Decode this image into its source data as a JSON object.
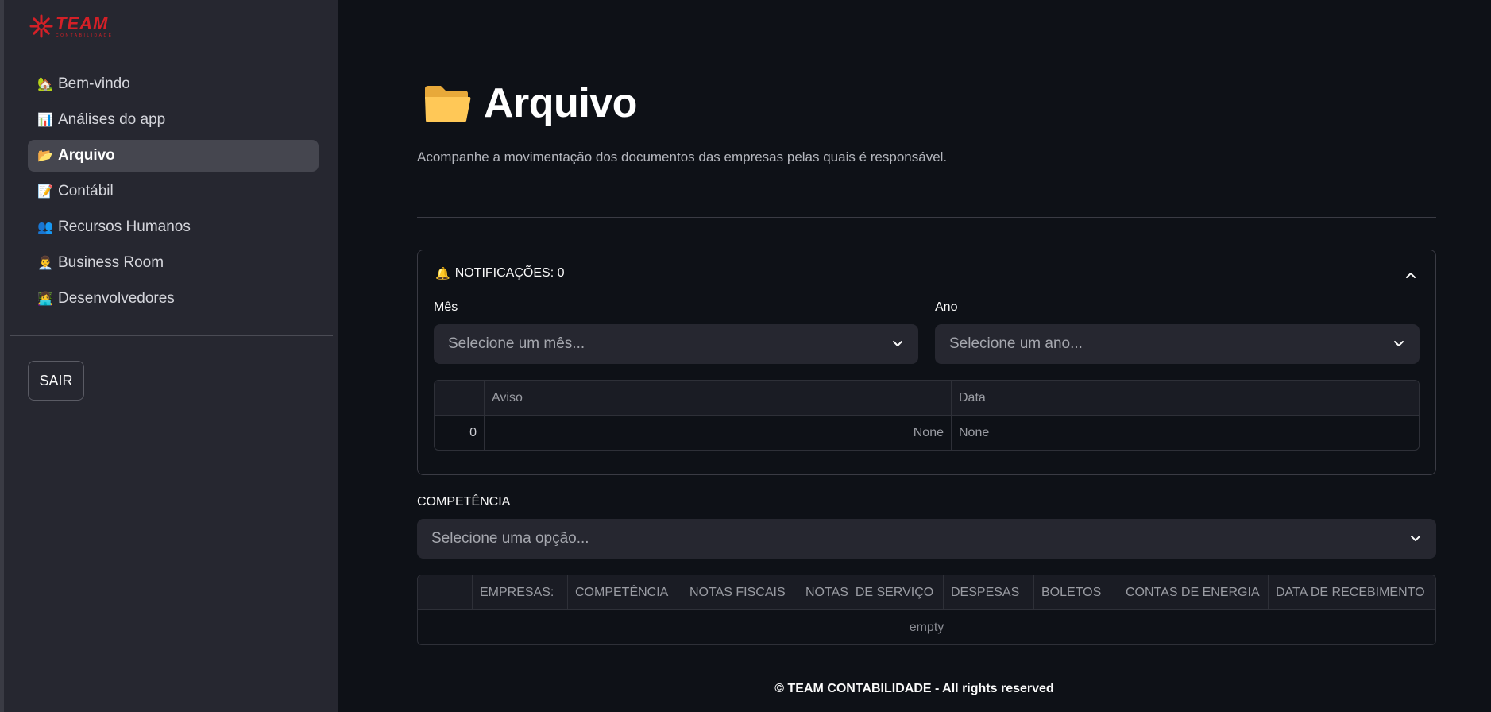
{
  "brand": {
    "name": "TEAM",
    "tagline": "CONTABILIDADE",
    "color": "#d42027"
  },
  "sidebar": {
    "items": [
      {
        "emoji": "🏡",
        "label": "Bem-vindo",
        "active": false
      },
      {
        "emoji": "📊",
        "label": "Análises do app",
        "active": false
      },
      {
        "emoji": "📂",
        "label": "Arquivo",
        "active": true
      },
      {
        "emoji": "📝",
        "label": "Contábil",
        "active": false
      },
      {
        "emoji": "👥",
        "label": "Recursos Humanos",
        "active": false
      },
      {
        "emoji": "👨‍💼",
        "label": "Business Room",
        "active": false
      },
      {
        "emoji": "👩‍💻",
        "label": "Desenvolvedores",
        "active": false
      }
    ],
    "logout_label": "SAIR"
  },
  "page": {
    "title": "Arquivo",
    "title_icon": "folder-icon",
    "subtitle": "Acompanhe a movimentação dos documentos das empresas pelas quais é responsável."
  },
  "notifications": {
    "bell": "🔔",
    "header": "NOTIFICAÇÕES: 0",
    "month": {
      "label": "Mês",
      "placeholder": "Selecione um mês..."
    },
    "year": {
      "label": "Ano",
      "placeholder": "Selecione um ano..."
    },
    "table": {
      "columns": [
        "",
        "Aviso",
        "Data"
      ],
      "rows": [
        {
          "index": "0",
          "aviso": "None",
          "data": "None"
        }
      ]
    }
  },
  "competencia": {
    "label": "COMPETÊNCIA",
    "placeholder": "Selecione uma opção..."
  },
  "documents_table": {
    "columns": [
      "",
      "EMPRESAS:",
      "COMPETÊNCIA",
      "NOTAS FISCAIS",
      "NOTAS  DE SERVIÇO",
      "DESPESAS",
      "BOLETOS",
      "CONTAS DE ENERGIA",
      "DATA DE RECEBIMENTO"
    ],
    "empty_text": "empty"
  },
  "footer": {
    "text": "© TEAM CONTABILIDADE - All rights reserved"
  }
}
